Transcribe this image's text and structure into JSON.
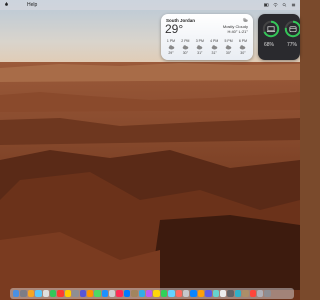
{
  "menubar": {
    "apple_icon": "apple-icon",
    "app_menu": "...",
    "help": "Help"
  },
  "weather": {
    "location": "South Jordan",
    "temperature": "29°",
    "condition": "Mostly Cloudy",
    "high_low": "H:40° L:21°",
    "hours": [
      {
        "time": "1 PM",
        "temp": "29°"
      },
      {
        "time": "2 PM",
        "temp": "30°"
      },
      {
        "time": "3 PM",
        "temp": "31°"
      },
      {
        "time": "4 PM",
        "temp": "31°"
      },
      {
        "time": "5 PM",
        "temp": "30°"
      },
      {
        "time": "6 PM",
        "temp": "30°"
      }
    ]
  },
  "batteries": [
    {
      "device": "laptop-icon",
      "percent": "68%",
      "level": 0.68
    },
    {
      "device": "case-icon",
      "percent": "77%",
      "level": 0.77
    }
  ],
  "colors": {
    "accent_green": "#34c759",
    "canyon": "#8b4a2b",
    "sky": "#c9d7e4"
  }
}
